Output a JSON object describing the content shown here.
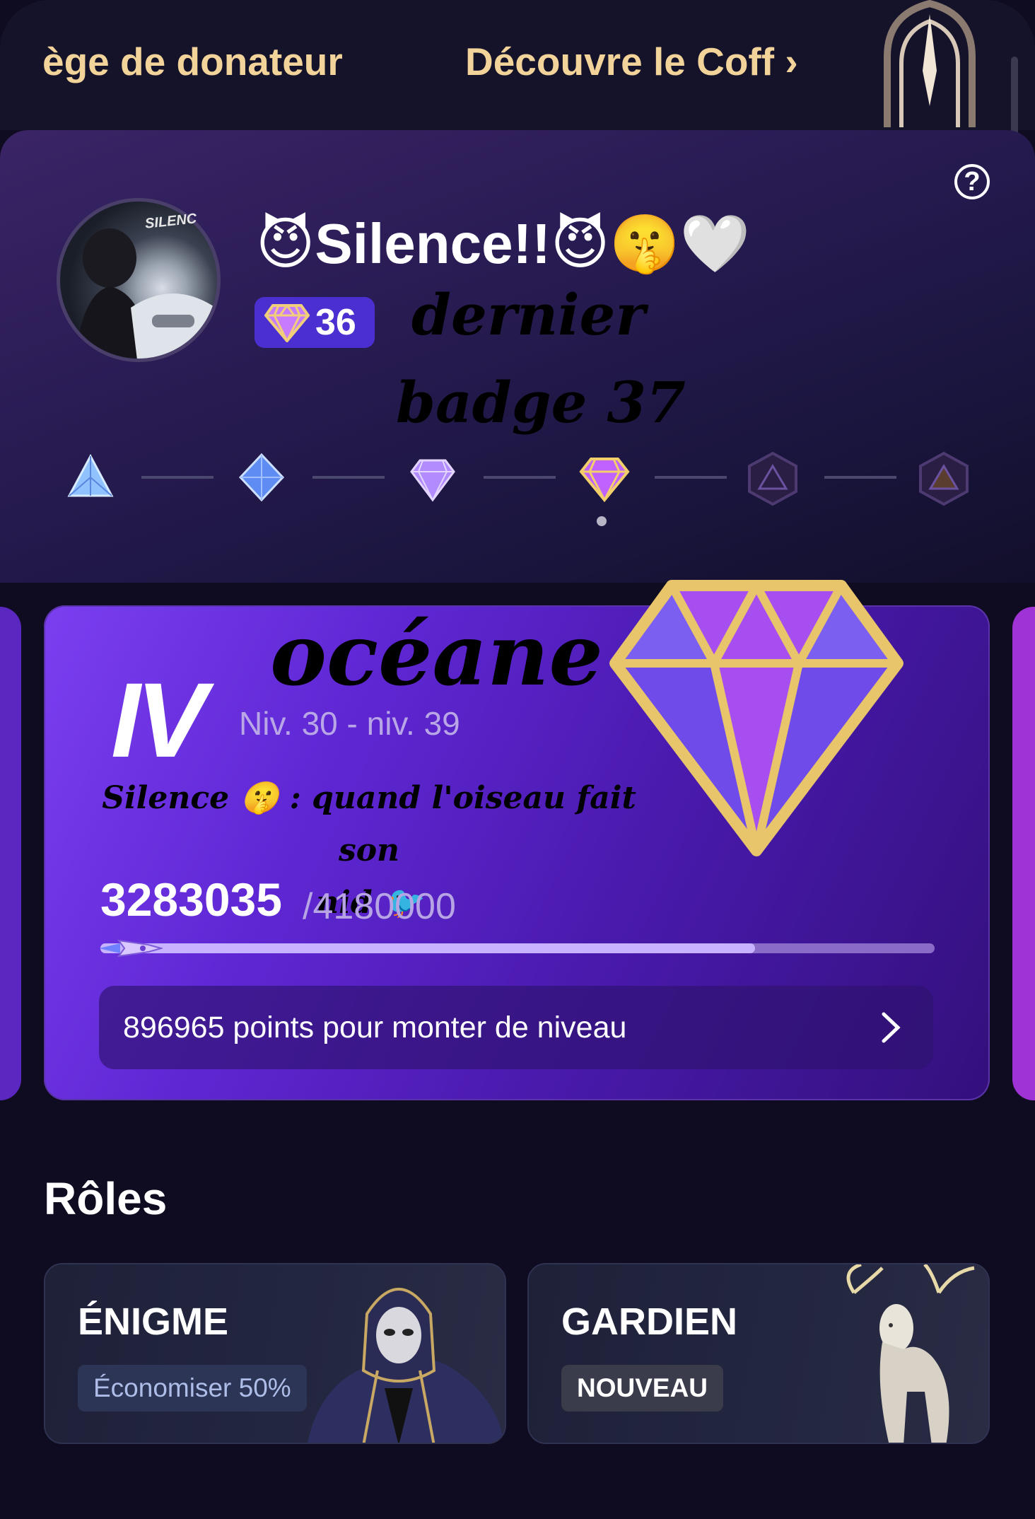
{
  "top_tabs": {
    "donor": "ège de donateur",
    "coffer": "Découvre le Coff",
    "coffer_chevron": "›"
  },
  "profile": {
    "username": "😈Silence!!😈🤫🤍",
    "gem_count": "36",
    "avatar_caption": "SILENC",
    "handwriting_line_1": "dernier",
    "handwriting_line_2": "badge 37"
  },
  "tiers": {
    "count": 6,
    "current_index": 3,
    "icons": [
      "pyramid-icon",
      "diamond-blue-icon",
      "gem-purple-icon",
      "gem-gold-icon",
      "locked-hexagon-icon",
      "locked-hexagon-icon"
    ]
  },
  "level_card": {
    "roman": "IV",
    "handwriting_title": "océane",
    "level_range": "Niv. 30 - niv. 39",
    "handwriting_note_1": "Silence 🤫 : quand l'oiseau fait son",
    "handwriting_note_2": "nid 🐦",
    "points_current": "3283035",
    "points_target": "/4180000",
    "progress_fraction": 0.785,
    "levelup_text": "896965 points pour monter de niveau"
  },
  "roles": {
    "section_title": "Rôles",
    "items": [
      {
        "name": "ÉNIGME",
        "badge": "Économiser 50%"
      },
      {
        "name": "GARDIEN",
        "badge": "NOUVEAU"
      }
    ]
  },
  "colors": {
    "accent_gold": "#f2d39a",
    "card_purple": "#5f27d4",
    "badge_blue": "#4b2fd0"
  }
}
